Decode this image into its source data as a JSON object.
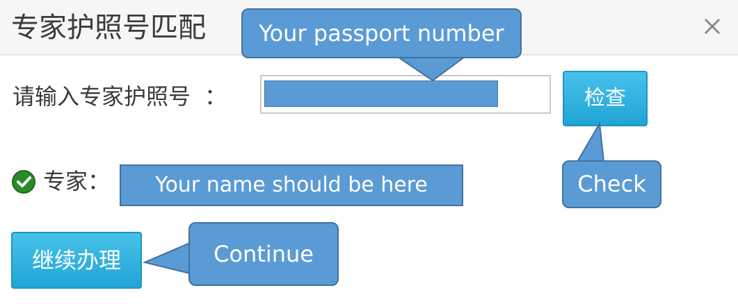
{
  "dialog": {
    "title": "专家护照号匹配",
    "close_label": "×"
  },
  "form": {
    "passport_label": "请输入专家护照号",
    "passport_colon": "：",
    "passport_value": "",
    "check_button": "检查",
    "expert_label": "专家：",
    "expert_name": "Your name should be here",
    "continue_button": "继续办理"
  },
  "annotations": {
    "passport": "Your passport number",
    "check": "Check",
    "continue": "Continue"
  },
  "colors": {
    "callout_fill": "#5b9bd5",
    "callout_border": "#41719c",
    "button_blue": "#2bb0e0",
    "success_green": "#2a8a2a"
  }
}
